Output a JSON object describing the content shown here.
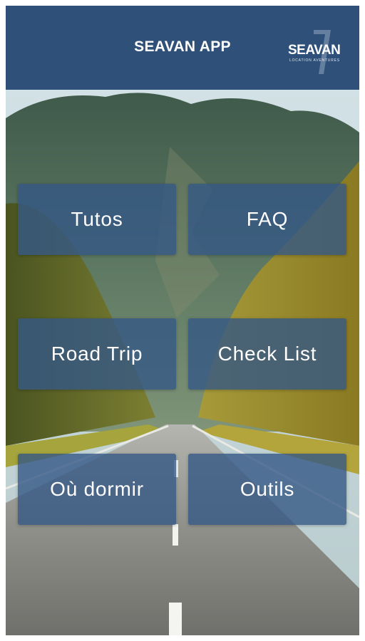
{
  "header": {
    "title": "SEAVAN APP",
    "logo": {
      "text": "SEAVAN",
      "tagline": "LOCATION AVENTURES",
      "icon": "seavan-7-logo"
    }
  },
  "menu": {
    "tiles": [
      {
        "label": "Tutos"
      },
      {
        "label": "FAQ"
      },
      {
        "label": "Road Trip"
      },
      {
        "label": "Check List"
      },
      {
        "label": "Où dormir"
      },
      {
        "label": "Outils"
      }
    ]
  },
  "colors": {
    "header_bg": "#2f5078",
    "tile_bg": "#345884",
    "text": "#ffffff"
  }
}
